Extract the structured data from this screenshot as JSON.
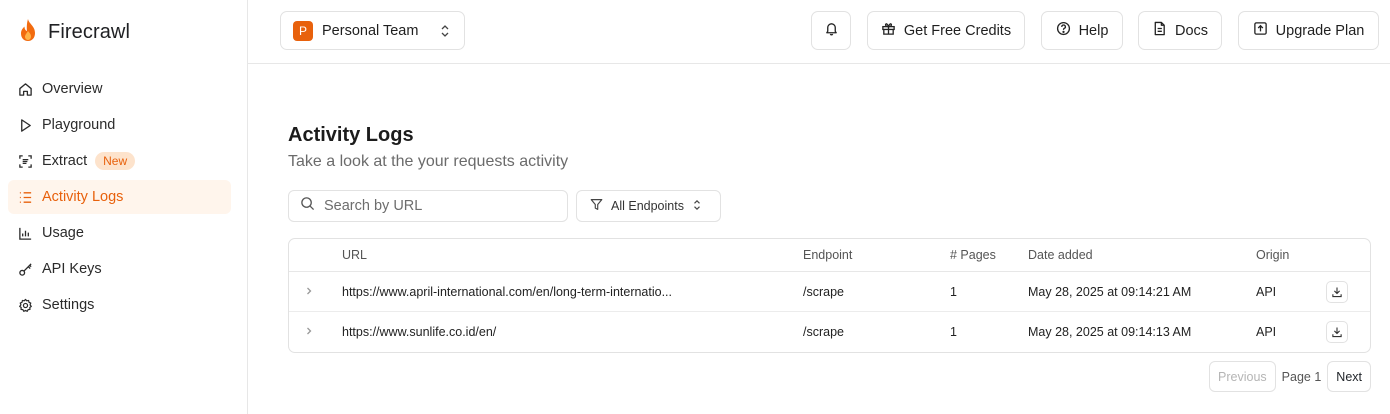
{
  "brand": {
    "name": "Firecrawl",
    "accent": "#e8610c"
  },
  "sidebar": {
    "items": [
      {
        "label": "Overview",
        "icon": "home-icon"
      },
      {
        "label": "Playground",
        "icon": "play-icon"
      },
      {
        "label": "Extract",
        "icon": "scan-text-icon",
        "badge": "New"
      },
      {
        "label": "Activity Logs",
        "icon": "list-icon",
        "active": true
      },
      {
        "label": "Usage",
        "icon": "bar-chart-icon"
      },
      {
        "label": "API Keys",
        "icon": "key-icon"
      },
      {
        "label": "Settings",
        "icon": "gear-icon"
      }
    ]
  },
  "header": {
    "team": {
      "initial": "P",
      "name": "Personal Team"
    },
    "get_credits": "Get Free Credits",
    "help": "Help",
    "docs": "Docs",
    "upgrade": "Upgrade Plan"
  },
  "main": {
    "title": "Activity Logs",
    "subtitle": "Take a look at the your requests activity",
    "search_placeholder": "Search by URL",
    "filter_label": "All Endpoints",
    "columns": {
      "url": "URL",
      "endpoint": "Endpoint",
      "pages": "# Pages",
      "date": "Date added",
      "origin": "Origin"
    },
    "rows": [
      {
        "url": "https://www.april-international.com/en/long-term-internatio...",
        "endpoint": "/scrape",
        "pages": "1",
        "date": "May 28, 2025 at 09:14:21 AM",
        "origin": "API"
      },
      {
        "url": "https://www.sunlife.co.id/en/",
        "endpoint": "/scrape",
        "pages": "1",
        "date": "May 28, 2025 at 09:14:13 AM",
        "origin": "API"
      }
    ],
    "pagination": {
      "previous": "Previous",
      "page": "Page 1",
      "next": "Next"
    }
  }
}
